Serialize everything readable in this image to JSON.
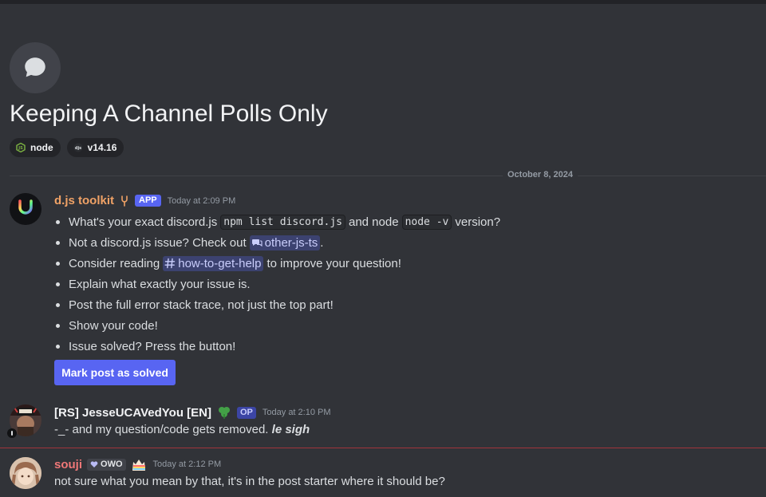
{
  "thread": {
    "title": "Keeping A Channel Polls Only",
    "tags": [
      {
        "label": "node",
        "icon": "node-js-icon"
      },
      {
        "label": "v14.16",
        "icon": "discordjs-icon"
      }
    ]
  },
  "date_divider": "October 8, 2024",
  "messages": [
    {
      "author": "d.js toolkit",
      "author_color": "#f0a266",
      "badge": "APP",
      "timestamp": "Today at 2:09 PM",
      "bullets": {
        "b1_pre": "What's your exact discord.js",
        "b1_code1": "npm list discord.js",
        "b1_mid": "and node",
        "b1_code2": "node -v",
        "b1_post": "version?",
        "b2_pre": "Not a discord.js issue? Check out",
        "b2_mention": "other-js-ts",
        "b2_post": ".",
        "b3_pre": "Consider reading",
        "b3_mention": "how-to-get-help",
        "b3_post": "to improve your question!",
        "b4": "Explain what exactly your issue is.",
        "b5": "Post the full error stack trace, not just the top part!",
        "b6": "Show your code!",
        "b7": "Issue solved? Press the button!"
      },
      "button_label": "Mark post as solved"
    },
    {
      "author": "[RS] JesseUCAVedYou [EN]",
      "author_color": "#f2f3f5",
      "badge": "OP",
      "timestamp": "Today at 2:10 PM",
      "text": "-_- and my question/code gets removed.",
      "text_em": "le sigh"
    },
    {
      "author": "souji",
      "author_color": "#f07878",
      "badge": "OWO",
      "timestamp": "Today at 2:12 PM",
      "text": "not sure what you mean by that, it's in the post starter where it should be?"
    }
  ],
  "colors": {
    "background": "#313338",
    "accent": "#5865f2",
    "new_messages_line": "#a1343b"
  }
}
